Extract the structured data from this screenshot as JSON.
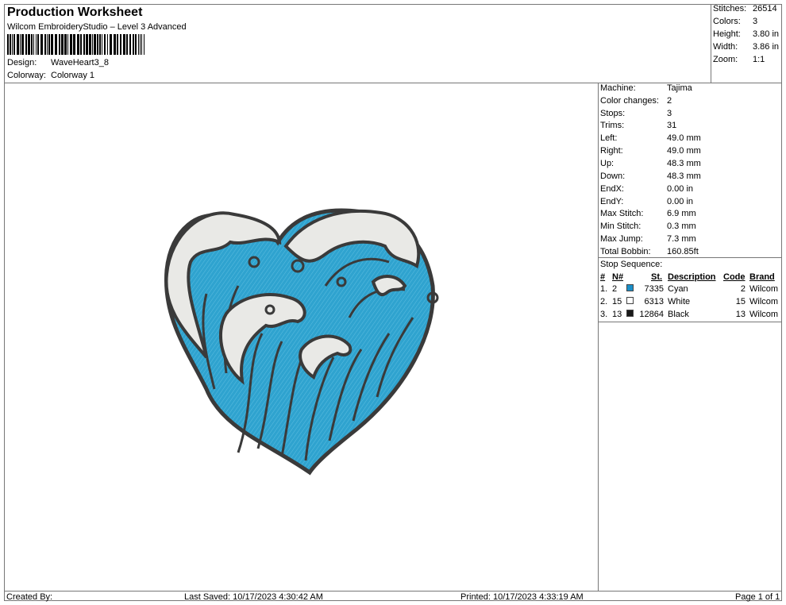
{
  "header": {
    "title": "Production Worksheet",
    "software": "Wilcom EmbroideryStudio – Level 3 Advanced",
    "design_label": "Design:",
    "design_value": "WaveHeart3_8",
    "colorway_label": "Colorway:",
    "colorway_value": "Colorway 1"
  },
  "summary": {
    "rows": [
      {
        "label": "Stitches:",
        "value": "26514"
      },
      {
        "label": "Colors:",
        "value": "3"
      },
      {
        "label": "Height:",
        "value": "3.80 in"
      },
      {
        "label": "Width:",
        "value": "3.86 in"
      },
      {
        "label": "Zoom:",
        "value": "1:1"
      }
    ]
  },
  "machine": {
    "rows": [
      {
        "label": "Machine:",
        "value": "Tajima"
      },
      {
        "label": "Color changes:",
        "value": "2"
      },
      {
        "label": "Stops:",
        "value": "3"
      },
      {
        "label": "Trims:",
        "value": "31"
      },
      {
        "label": "Left:",
        "value": "49.0 mm"
      },
      {
        "label": "Right:",
        "value": "49.0 mm"
      },
      {
        "label": "Up:",
        "value": "48.3 mm"
      },
      {
        "label": "Down:",
        "value": "48.3 mm"
      },
      {
        "label": "EndX:",
        "value": "0.00 in"
      },
      {
        "label": "EndY:",
        "value": "0.00 in"
      },
      {
        "label": "Max Stitch:",
        "value": "6.9 mm"
      },
      {
        "label": "Min Stitch:",
        "value": "0.3 mm"
      },
      {
        "label": "Max Jump:",
        "value": "7.3 mm"
      },
      {
        "label": "Total Bobbin:",
        "value": "160.85ft"
      }
    ]
  },
  "stop_sequence": {
    "title": "Stop Sequence:",
    "headers": {
      "num": "#",
      "n": "N#",
      "st": "St.",
      "desc": "Description",
      "code": "Code",
      "brand": "Brand"
    },
    "rows": [
      {
        "num": "1.",
        "n": "2",
        "color": "#1a8fc8",
        "st": "7335",
        "desc": "Cyan",
        "code": "2",
        "brand": "Wilcom"
      },
      {
        "num": "2.",
        "n": "15",
        "color": "#ffffff",
        "st": "6313",
        "desc": "White",
        "code": "15",
        "brand": "Wilcom"
      },
      {
        "num": "3.",
        "n": "13",
        "color": "#1a1a1a",
        "st": "12864",
        "desc": "Black",
        "code": "13",
        "brand": "Wilcom"
      }
    ]
  },
  "footer": {
    "created_by": "Created By:",
    "last_saved": "Last Saved: 10/17/2023 4:30:42 AM",
    "printed": "Printed: 10/17/2023 4:33:19 AM",
    "page": "Page 1 of 1"
  },
  "colors": {
    "cyan": "#2fa3cf",
    "white_thread": "#e9e9e6",
    "outline": "#3a3a3a"
  }
}
